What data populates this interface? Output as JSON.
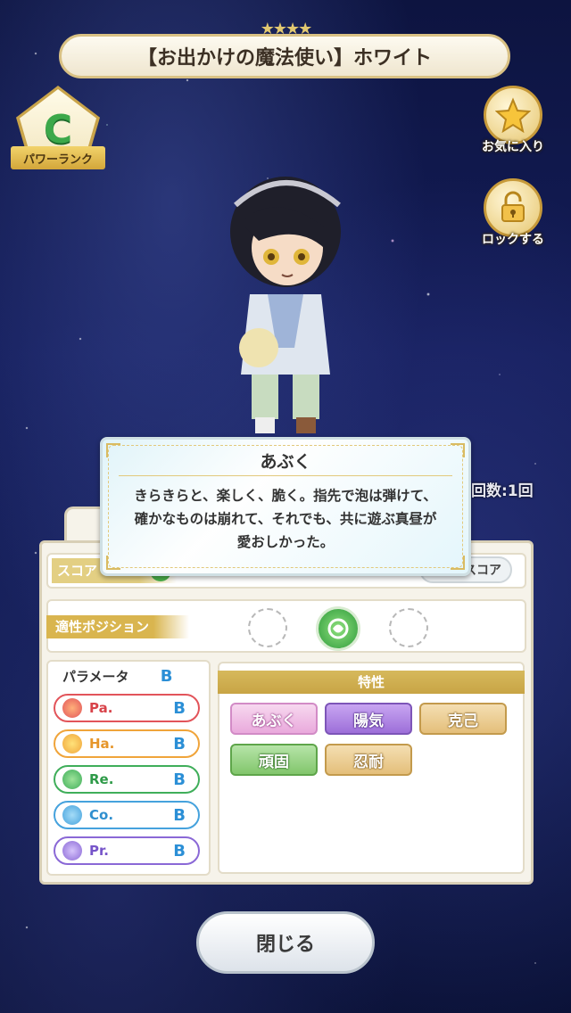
{
  "header": {
    "stars": "★★★★",
    "card_title": "【お出かけの魔法使い】ホワイト"
  },
  "power_rank": {
    "grade": "C",
    "label": "パワーランク"
  },
  "side_buttons": {
    "favorite_label": "お気に入り",
    "lock_label": "ロックする"
  },
  "skill_popup": {
    "title": "あぶく",
    "description_lines": [
      "きらきらと、楽しく、脆く。指先で泡は弾けて、",
      "確かなものは崩れて、それでも、共に遊ぶ真昼が",
      "愛おしかった。"
    ]
  },
  "stats_panel": {
    "count_text": "回数:1回",
    "score_label": "スコア",
    "score_button_label": "スコア",
    "position_label": "適性ポジション",
    "parameter_title": "パラメータ",
    "parameter_overall_grade": "B",
    "parameters": [
      {
        "name": "Pa.",
        "grade": "B",
        "color": "#e2545a",
        "icon": "fire-icon"
      },
      {
        "name": "Ha.",
        "grade": "B",
        "color": "#f0a43a",
        "icon": "sun-icon"
      },
      {
        "name": "Re.",
        "grade": "B",
        "color": "#3fae5a",
        "icon": "clover-icon"
      },
      {
        "name": "Co.",
        "grade": "B",
        "color": "#45a2dd",
        "icon": "wave-icon"
      },
      {
        "name": "Pr.",
        "grade": "B",
        "color": "#8a68d6",
        "icon": "diamond-icon"
      }
    ],
    "traits_title": "特性",
    "traits": [
      {
        "label": "あぶく",
        "style": "pink"
      },
      {
        "label": "陽気",
        "style": "purple"
      },
      {
        "label": "克己",
        "style": "gold"
      },
      {
        "label": "頑固",
        "style": "green"
      },
      {
        "label": "忍耐",
        "style": "gold"
      }
    ]
  },
  "footer": {
    "close_label": "閉じる"
  },
  "colors": {
    "background": "#141d5a",
    "accent_gold": "#d9b54f",
    "grade_blue": "#2b8fd6",
    "rank_green": "#3ca84a"
  }
}
